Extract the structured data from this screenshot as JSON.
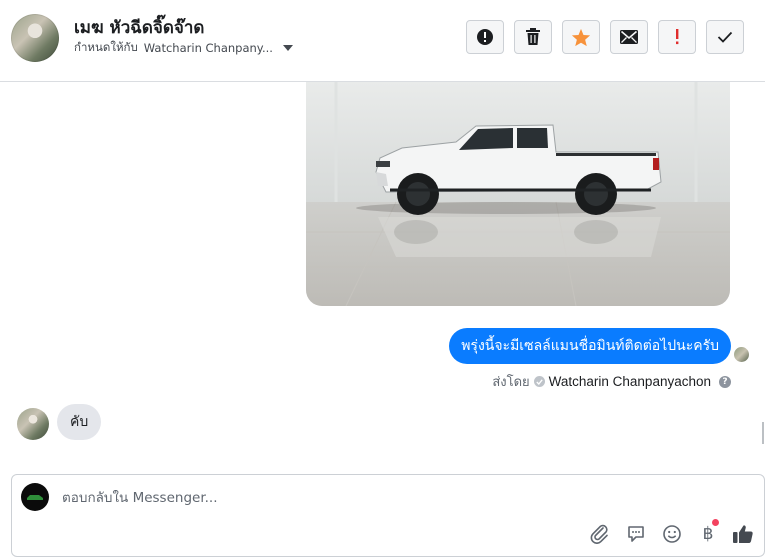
{
  "header": {
    "contact_name": "เมฆ หัวฉีดจิ๊ดจ๊าด",
    "assign_prefix": "กำหนดให้กับ",
    "assign_name": "Watcharin Chanpany...",
    "toolbar": [
      {
        "icon": "alert-circle-icon",
        "label": "Mark as spam"
      },
      {
        "icon": "trash-icon",
        "label": "Delete"
      },
      {
        "icon": "star-icon",
        "label": "Star"
      },
      {
        "icon": "envelope-icon",
        "label": "Mark as unread"
      },
      {
        "icon": "exclamation-icon",
        "label": "Follow up"
      },
      {
        "icon": "check-icon",
        "label": "Mark as done"
      }
    ],
    "colors": {
      "star": "#f7923b",
      "exclamation": "#e02d2d"
    }
  },
  "messages": {
    "outgoing_text": "พรุ่งนี้จะมีเซลล์แมนชื่อมินท์ติดต่อไปนะครับ",
    "sent_by_prefix": "ส่งโดย",
    "sent_by_name": "Watcharin Chanpanyachon",
    "help_glyph": "?",
    "incoming_text": "คับ"
  },
  "composer": {
    "placeholder": "ตอบกลับใน Messenger...",
    "value": "",
    "icons": [
      "paperclip-icon",
      "saved-replies-icon",
      "emoji-icon",
      "baht-payment-icon",
      "like-icon"
    ],
    "baht_glyph": "฿"
  },
  "colors": {
    "accent": "#0a7cff",
    "incoming_bubble": "#e4e6eb"
  }
}
